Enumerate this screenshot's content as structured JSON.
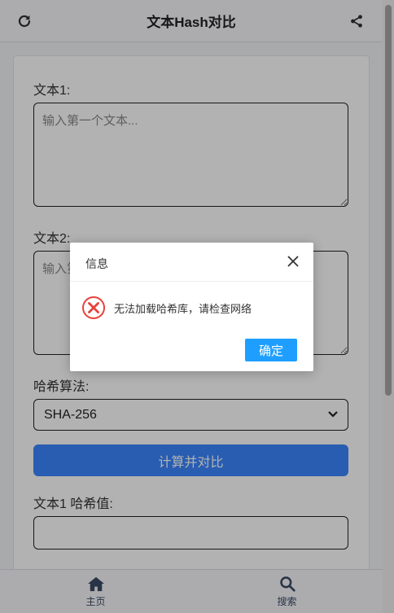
{
  "header": {
    "title": "文本Hash对比"
  },
  "form": {
    "text1_label": "文本1:",
    "text1_placeholder": "输入第一个文本...",
    "text2_label": "文本2:",
    "text2_placeholder": "输入第二个文本...",
    "algo_label": "哈希算法:",
    "algo_selected": "SHA-256",
    "compute_button": "计算并对比",
    "hash1_label": "文本1 哈希值:"
  },
  "bottom_nav": {
    "home_label": "主页",
    "search_label": "搜索"
  },
  "dialog": {
    "title": "信息",
    "message": "无法加载哈希库，请检查网络",
    "confirm_label": "确定"
  },
  "colors": {
    "accent": "#3a86ff",
    "dialog_button": "#1e9fff",
    "error": "#e8413b"
  }
}
